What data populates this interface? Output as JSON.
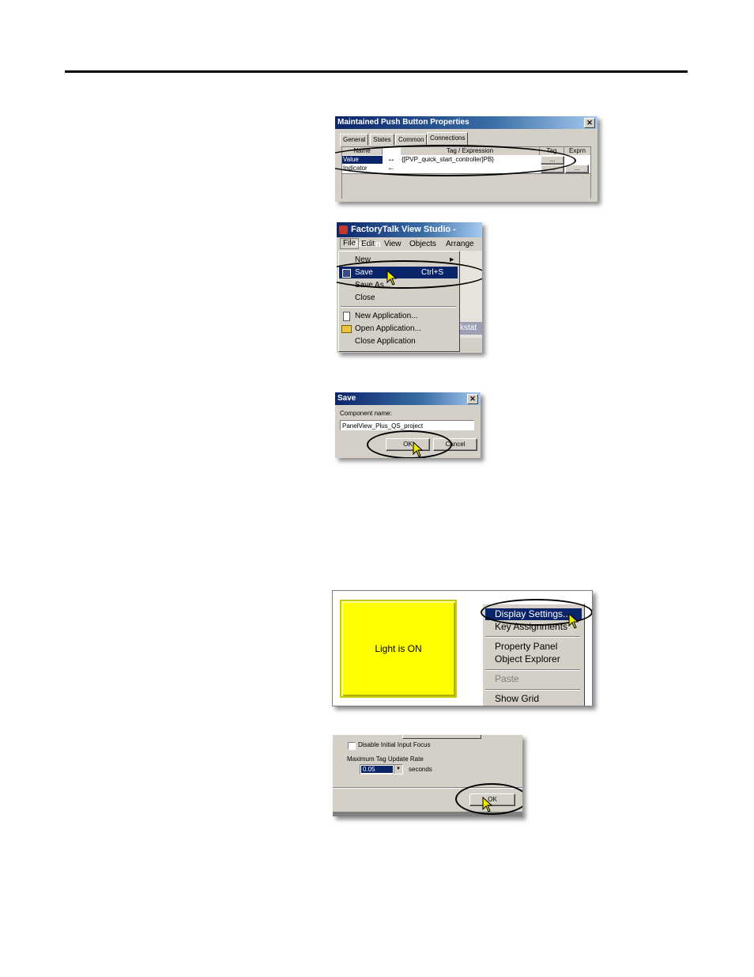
{
  "dialog1": {
    "title": "Maintained Push Button Properties",
    "close": "✕",
    "tabs": [
      "General",
      "States",
      "Common",
      "Connections"
    ],
    "columns": [
      "Name",
      "Tag / Expression",
      "Tag",
      "Exprn"
    ],
    "rows": [
      {
        "name": "Value",
        "arrow": "↔",
        "tag": "{[PVP_quick_start_controller]PB}",
        "b1": "...",
        "b2": ""
      },
      {
        "name": "Indicator",
        "arrow": "←",
        "tag": "",
        "b1": "...",
        "b2": "..."
      }
    ]
  },
  "menu": {
    "title": "FactoryTalk View Studio - Machin",
    "menubar": [
      "File",
      "Edit",
      "View",
      "Objects",
      "Arrange"
    ],
    "items": [
      "New",
      "Save",
      "Save As...",
      "Close",
      "New Application...",
      "Open Application...",
      "Close Application"
    ],
    "shortcut": "Ctrl+S",
    "partial": "kstat"
  },
  "save": {
    "title": "Save",
    "close": "✕",
    "label": "Component name:",
    "value": "PanelView_Plus_QS_project",
    "ok": "OK",
    "cancel": "Cancel"
  },
  "display": {
    "light": "Light is ON",
    "items": [
      "Display Settings...",
      "Key Assignments",
      "Property Panel",
      "Object Explorer",
      "Paste",
      "Show Grid"
    ]
  },
  "settings": {
    "checkbox": "Disable Initial Input Focus",
    "rate_label": "Maximum Tag Update Rate",
    "rate_value": "0.05",
    "seconds": "seconds",
    "ok": "OK"
  },
  "colors": {
    "selection": "#0a246a",
    "yellow": "#ffff00",
    "cursor": "#e8e800"
  }
}
